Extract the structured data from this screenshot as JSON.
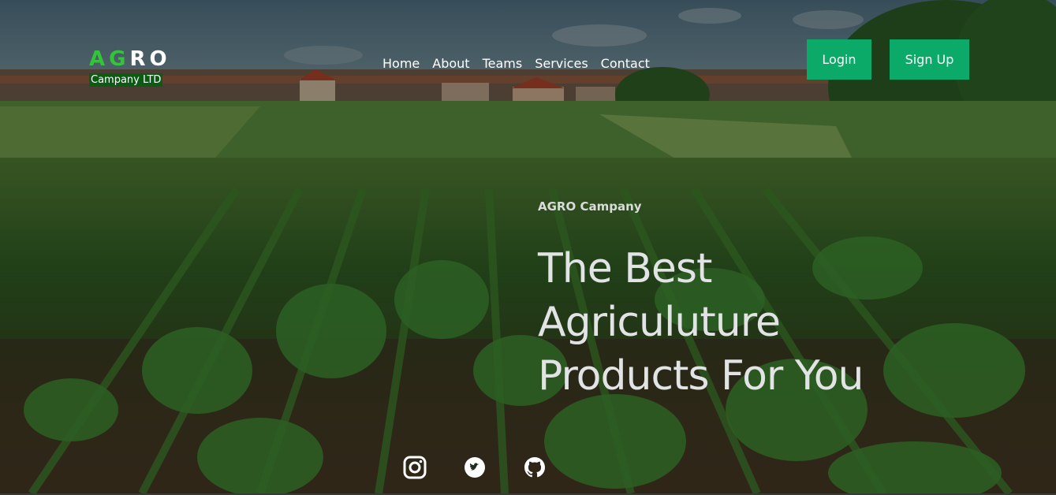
{
  "logo": {
    "letters": [
      "A",
      "G",
      "R",
      "O"
    ],
    "letter_colors": [
      "#34c43a",
      "#34c43a",
      "#ffffff",
      "#ffffff"
    ],
    "subtitle": "Campany LTD"
  },
  "nav": {
    "items": [
      {
        "label": "Home"
      },
      {
        "label": "About"
      },
      {
        "label": "Teams"
      },
      {
        "label": "Services"
      },
      {
        "label": "Contact"
      }
    ]
  },
  "auth": {
    "login_label": "Login",
    "signup_label": "Sign Up"
  },
  "hero": {
    "tagline": "AGRO Campany",
    "headline_lines": [
      "The Best",
      "Agriculuture",
      "Products For You"
    ]
  },
  "social": {
    "icons": [
      "instagram-icon",
      "twitter-icon",
      "github-icon"
    ]
  },
  "colors": {
    "accent": "#0baa69",
    "logo_green": "#34c43a",
    "logo_sub_bg": "#0c5b14"
  }
}
